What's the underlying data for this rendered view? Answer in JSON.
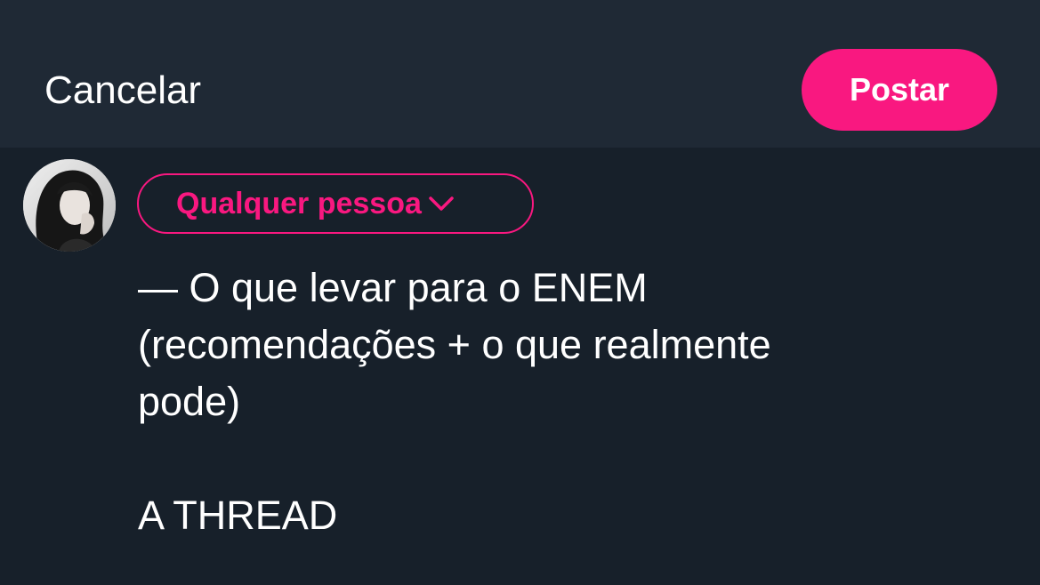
{
  "header": {
    "cancel_label": "Cancelar",
    "post_label": "Postar",
    "accent_color": "#f91880"
  },
  "composer": {
    "avatar_icon": "user-avatar-photo",
    "audience_label": "Qualquer pessoa",
    "audience_icon": "chevron-down-icon",
    "text_lines": [
      "— O que levar para o ENEM",
      "(recomendações + o que realmente",
      "pode)",
      "",
      "A THREAD"
    ]
  }
}
